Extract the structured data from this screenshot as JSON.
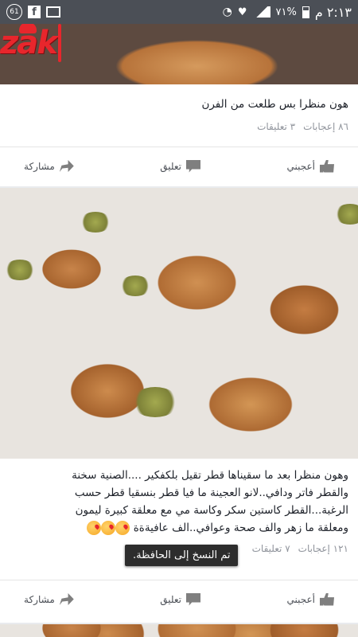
{
  "status_bar": {
    "time": "٢:١٣ م",
    "battery": "٧١%",
    "notification_count": "61"
  },
  "logo": {
    "text": "zak"
  },
  "posts": [
    {
      "caption": "هون منظرا بس طلعت من الفرن",
      "likes": "٨٦ إعجابات",
      "comments": "٣ تعليقات",
      "like_label": "أعجبني",
      "comment_label": "تعليق",
      "share_label": "مشاركة"
    },
    {
      "caption_lines": [
        "وهون منظرا بعد ما سقيناها  قطر تقيل بلكفكير ....الصنية سخنة",
        "والقطر فاتر ودافي..لانو العجينة ما فيا قطر بنسقيا قطر حسب",
        "الرغبة...القطر كاستين سكر وكاسة مي مع معلقة كبيرة ليمون",
        "ومعلقة ما زهر والف صحة وعوافي..الف عافيةةة"
      ],
      "likes": "١٢١ إعجابات",
      "comments": "٧ تعليقات",
      "like_label": "أعجبني",
      "comment_label": "تعليق",
      "share_label": "مشاركة"
    }
  ],
  "toast": "تم النسخ إلى الحافظة."
}
